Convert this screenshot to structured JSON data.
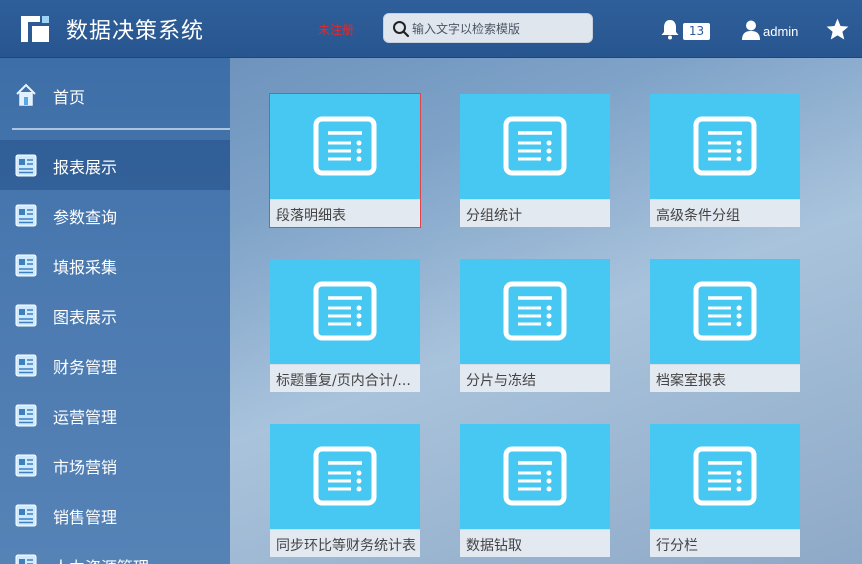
{
  "header": {
    "title": "数据决策系统",
    "unregistered": "未注册",
    "search_placeholder": "输入文字以检索模版",
    "notification_count": "13",
    "username": "admin"
  },
  "sidebar": {
    "items": [
      {
        "label": "首页",
        "icon": "home-icon"
      },
      {
        "label": "报表展示",
        "icon": "report-icon",
        "active": true
      },
      {
        "label": "参数查询",
        "icon": "report-icon"
      },
      {
        "label": "填报采集",
        "icon": "report-icon"
      },
      {
        "label": "图表展示",
        "icon": "report-icon"
      },
      {
        "label": "财务管理",
        "icon": "report-icon"
      },
      {
        "label": "运营管理",
        "icon": "report-icon"
      },
      {
        "label": "市场营销",
        "icon": "report-icon"
      },
      {
        "label": "销售管理",
        "icon": "report-icon"
      },
      {
        "label": "人力资源管理",
        "icon": "report-icon"
      }
    ]
  },
  "tiles": [
    {
      "label": "段落明细表",
      "selected": true
    },
    {
      "label": "分组统计"
    },
    {
      "label": "高级条件分组"
    },
    {
      "label": "标题重复/页内合计/..."
    },
    {
      "label": "分片与冻结"
    },
    {
      "label": "档案室报表"
    },
    {
      "label": "同步环比等财务统计表"
    },
    {
      "label": "数据钻取"
    },
    {
      "label": "行分栏"
    }
  ],
  "colors": {
    "header": "#2f5f9a",
    "tile": "#46c8f2",
    "tile_label_bg": "#e3e9f0",
    "selected_outline": "#e0454a",
    "unregistered": "#e8272a"
  }
}
